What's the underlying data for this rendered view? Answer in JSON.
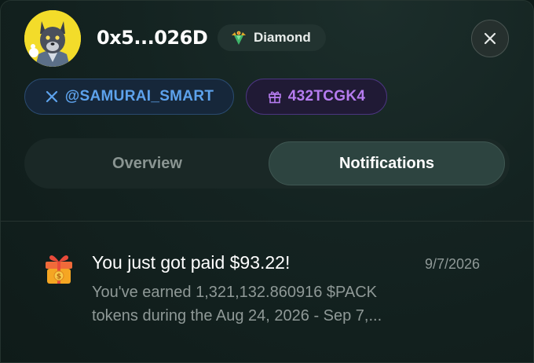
{
  "profile": {
    "address": "0x5...026D",
    "rank": "Diamond",
    "twitter_handle": "@SAMURAI_SMART",
    "referral_code": "432TCGK4"
  },
  "tabs": [
    {
      "label": "Overview",
      "active": false
    },
    {
      "label": "Notifications",
      "active": true
    }
  ],
  "notification": {
    "title": "You just got paid $93.22!",
    "date": "9/7/2026",
    "body": "You've earned 1,321,132.860916 $PACK tokens during the Aug 24, 2026 - Sep 7,..."
  },
  "colors": {
    "background": "#142321",
    "twitter_chip": "#5da2ec",
    "referral_chip": "#b67cf0",
    "avatar_background": "#f3dc2a"
  }
}
